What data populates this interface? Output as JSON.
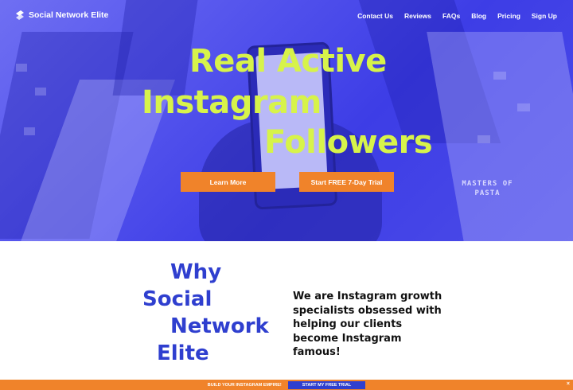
{
  "brand": {
    "name": "Social Network Elite"
  },
  "nav": {
    "items": [
      "Contact Us",
      "Reviews",
      "FAQs",
      "Blog",
      "Pricing",
      "Sign Up"
    ]
  },
  "hero": {
    "headline_lines": [
      "Real Active",
      "Instagram",
      "Followers"
    ],
    "learn_more_label": "Learn More",
    "trial_label": "Start FREE 7-Day Trial",
    "neon_sign": "MASTERS OF PASTA"
  },
  "why": {
    "title_lines": [
      "Why",
      "Social",
      "Network",
      "Elite"
    ],
    "description": "We are Instagram growth specialists obsessed with helping our clients become Instagram famous!"
  },
  "promo_bar": {
    "text": "BUILD YOUR INSTAGRAM EMPIRE!",
    "cta_label": "START MY FREE TRIAL",
    "close_symbol": "×"
  },
  "colors": {
    "hero_blue": "#4c4ce8",
    "headline_lime": "#d7f34a",
    "accent_orange": "#f0832a",
    "title_blue": "#2f3fcf"
  }
}
